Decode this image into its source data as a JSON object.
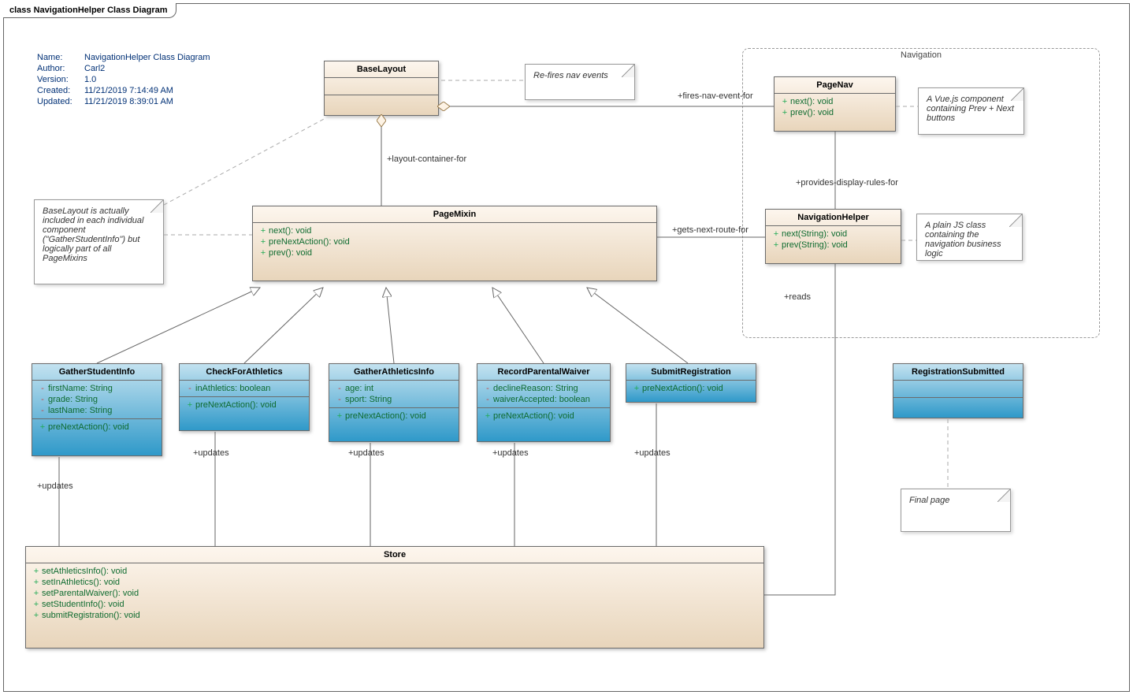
{
  "frame": {
    "kind": "class",
    "title": "NavigationHelper Class Diagram"
  },
  "metadata": {
    "name": "NavigationHelper Class Diagram",
    "author": "Carl2",
    "version": "1.0",
    "created": "11/21/2019 7:14:49 AM",
    "updated": "11/21/2019 8:39:01 AM",
    "labels": {
      "name": "Name:",
      "author": "Author:",
      "version": "Version:",
      "created": "Created:",
      "updated": "Updated:"
    }
  },
  "navigation_box": {
    "title": "Navigation"
  },
  "classes": {
    "BaseLayout": {
      "title": "BaseLayout"
    },
    "PageNav": {
      "title": "PageNav",
      "ops": [
        {
          "vis": "+",
          "sig": "next(): void"
        },
        {
          "vis": "+",
          "sig": "prev(): void"
        }
      ]
    },
    "NavigationHelper": {
      "title": "NavigationHelper",
      "ops": [
        {
          "vis": "+",
          "sig": "next(String): void"
        },
        {
          "vis": "+",
          "sig": "prev(String): void"
        }
      ]
    },
    "PageMixin": {
      "title": "PageMixin",
      "ops": [
        {
          "vis": "+",
          "sig": "next(): void"
        },
        {
          "vis": "+",
          "sig": "preNextAction(): void"
        },
        {
          "vis": "+",
          "sig": "prev(): void"
        }
      ]
    },
    "GatherStudentInfo": {
      "title": "GatherStudentInfo",
      "attrs": [
        {
          "vis": "-",
          "sig": "firstName: String"
        },
        {
          "vis": "-",
          "sig": "grade: String"
        },
        {
          "vis": "-",
          "sig": "lastName: String"
        }
      ],
      "ops": [
        {
          "vis": "+",
          "sig": "preNextAction(): void"
        }
      ]
    },
    "CheckForAthletics": {
      "title": "CheckForAthletics",
      "attrs": [
        {
          "vis": "-",
          "sig": "inAthletics: boolean"
        }
      ],
      "ops": [
        {
          "vis": "+",
          "sig": "preNextAction(): void"
        }
      ]
    },
    "GatherAthleticsInfo": {
      "title": "GatherAthleticsInfo",
      "attrs": [
        {
          "vis": "-",
          "sig": "age: int"
        },
        {
          "vis": "-",
          "sig": "sport: String"
        }
      ],
      "ops": [
        {
          "vis": "+",
          "sig": "preNextAction(): void"
        }
      ]
    },
    "RecordParentalWaiver": {
      "title": "RecordParentalWaiver",
      "attrs": [
        {
          "vis": "-",
          "sig": "declineReason: String"
        },
        {
          "vis": "-",
          "sig": "waiverAccepted: boolean"
        }
      ],
      "ops": [
        {
          "vis": "+",
          "sig": "preNextAction(): void"
        }
      ]
    },
    "SubmitRegistration": {
      "title": "SubmitRegistration",
      "ops": [
        {
          "vis": "+",
          "sig": "preNextAction(): void"
        }
      ]
    },
    "RegistrationSubmitted": {
      "title": "RegistrationSubmitted"
    },
    "Store": {
      "title": "Store",
      "ops": [
        {
          "vis": "+",
          "sig": "setAthleticsInfo(): void"
        },
        {
          "vis": "+",
          "sig": "setInAthletics(): void"
        },
        {
          "vis": "+",
          "sig": "setParentalWaiver(): void"
        },
        {
          "vis": "+",
          "sig": "setStudentInfo(): void"
        },
        {
          "vis": "+",
          "sig": "submitRegistration(): void"
        }
      ]
    }
  },
  "notes": {
    "refire": "Re-fires nav events",
    "baselayout": "BaseLayout is actually included in each individual component (\"GatherStudentInfo\") but logically part of all PageMixins",
    "pagenav": "A Vue.js component containing Prev + Next buttons",
    "navhelper": "A plain JS class containing the navigation business logic",
    "finalpage": "Final page"
  },
  "labels": {
    "fires_nav": "+fires-nav-event-for",
    "layout": "+layout-container-for",
    "provides": "+provides-display-rules-for",
    "gets_route": "+gets-next-route-for",
    "reads": "+reads",
    "updates": "+updates"
  }
}
